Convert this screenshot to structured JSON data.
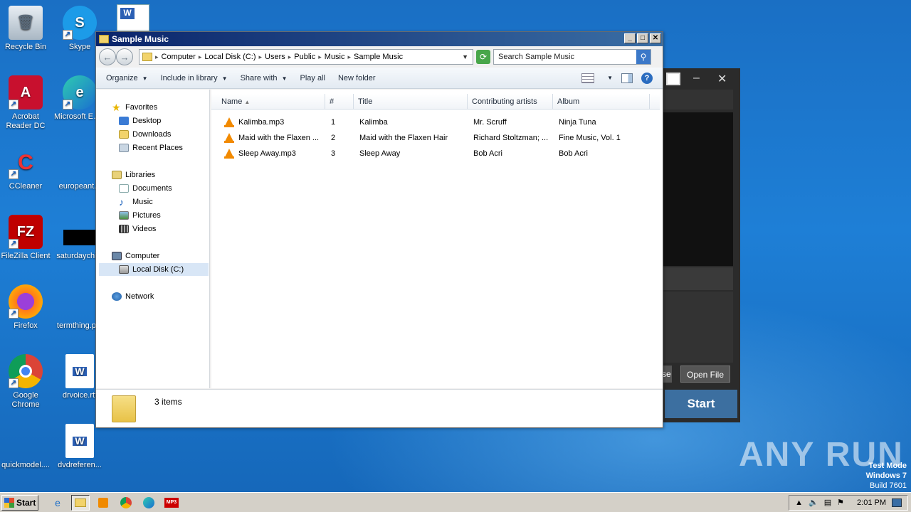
{
  "desktop": {
    "icons": [
      {
        "label": "Recycle Bin"
      },
      {
        "label": "Skype"
      },
      {
        "label": "Acrobat Reader DC"
      },
      {
        "label": "Microsoft Edge"
      },
      {
        "label": "CCleaner"
      },
      {
        "label": "europeant..."
      },
      {
        "label": "FileZilla Client"
      },
      {
        "label": "saturdaychi..."
      },
      {
        "label": "Firefox"
      },
      {
        "label": "termthing.p..."
      },
      {
        "label": "Google Chrome"
      },
      {
        "label": "drvoice.rtf"
      },
      {
        "label": "quickmodel...."
      },
      {
        "label": "dvdreferen..."
      }
    ]
  },
  "bg_app": {
    "open_file": "Open File",
    "btn_fragment": "se",
    "start": "Start"
  },
  "window": {
    "title": "Sample Music",
    "address": {
      "crumbs": [
        "Computer",
        "Local Disk (C:)",
        "Users",
        "Public",
        "Music",
        "Sample Music"
      ]
    },
    "search_placeholder": "Search Sample Music",
    "toolbar": {
      "organize": "Organize",
      "include": "Include in library",
      "share": "Share with",
      "play_all": "Play all",
      "new_folder": "New folder"
    },
    "nav": {
      "favorites": "Favorites",
      "desktop": "Desktop",
      "downloads": "Downloads",
      "recent": "Recent Places",
      "libraries": "Libraries",
      "documents": "Documents",
      "music": "Music",
      "pictures": "Pictures",
      "videos": "Videos",
      "computer": "Computer",
      "local_disk": "Local Disk (C:)",
      "network": "Network"
    },
    "columns": {
      "name": "Name",
      "num": "#",
      "title": "Title",
      "artists": "Contributing artists",
      "album": "Album"
    },
    "files": [
      {
        "name": "Kalimba.mp3",
        "num": "1",
        "title": "Kalimba",
        "artists": "Mr. Scruff",
        "album": "Ninja Tuna"
      },
      {
        "name": "Maid with the Flaxen ...",
        "num": "2",
        "title": "Maid with the Flaxen Hair",
        "artists": "Richard Stoltzman; ...",
        "album": "Fine Music, Vol. 1"
      },
      {
        "name": "Sleep Away.mp3",
        "num": "3",
        "title": "Sleep Away",
        "artists": "Bob Acri",
        "album": "Bob Acri"
      }
    ],
    "status": "3 items"
  },
  "taskbar": {
    "start": "Start",
    "clock": "2:01 PM"
  },
  "overlay": {
    "watermark": "ANY RUN",
    "test_mode": "Test Mode",
    "os": "Windows 7",
    "build": "Build 7601"
  }
}
